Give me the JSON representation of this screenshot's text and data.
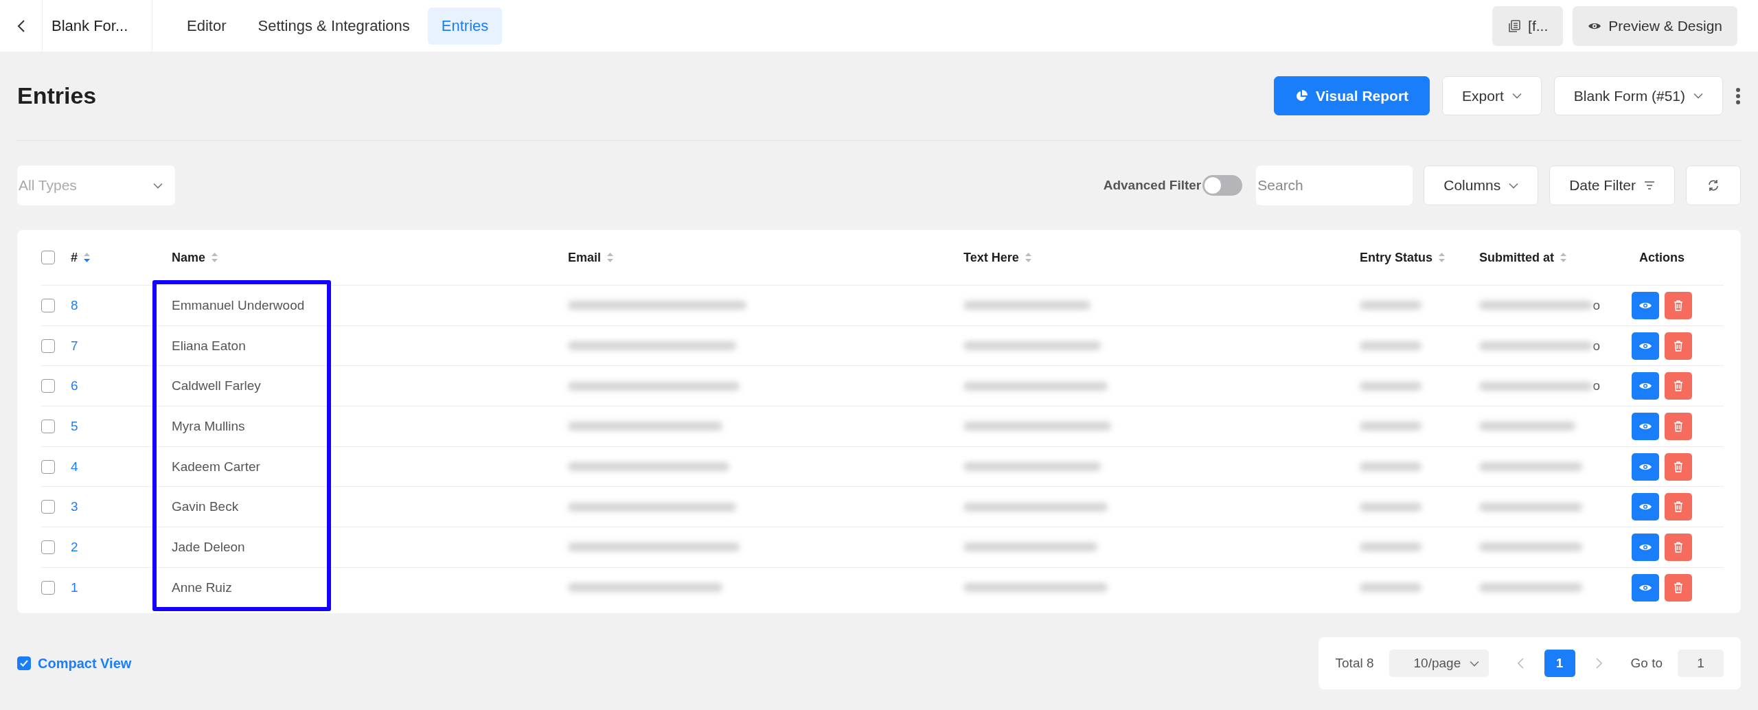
{
  "topbar": {
    "form_title": "Blank For...",
    "tabs": [
      {
        "label": "Editor",
        "selected": false
      },
      {
        "label": "Settings & Integrations",
        "selected": false
      },
      {
        "label": "Entries",
        "selected": true
      }
    ],
    "shortcode_button": "[f...",
    "preview_button": "Preview & Design"
  },
  "header": {
    "title": "Entries",
    "visual_report": "Visual Report",
    "export": "Export",
    "form_select": "Blank Form (#51)"
  },
  "filters": {
    "type_select": {
      "placeholder": "All Types"
    },
    "advanced_filter": {
      "label": "Advanced Filter",
      "on": false
    },
    "search": {
      "placeholder": "Search"
    },
    "columns_button": "Columns",
    "date_filter_button": "Date Filter"
  },
  "table": {
    "select_all": {
      "checked": false
    },
    "name_column_highlighted": true,
    "columns": [
      {
        "label": "#",
        "sortable": true,
        "sorted_desc": true
      },
      {
        "label": "Name",
        "sortable": true,
        "sorted_desc": false
      },
      {
        "label": "Email",
        "sortable": true,
        "sorted_desc": false
      },
      {
        "label": "Text Here",
        "sortable": true,
        "sorted_desc": false
      },
      {
        "label": "Entry Status",
        "sortable": true,
        "sorted_desc": false
      },
      {
        "label": "Submitted at",
        "sortable": true,
        "sorted_desc": false
      },
      {
        "label": "Actions",
        "sortable": false
      }
    ],
    "rows": [
      {
        "id": "8",
        "name": "Emmanuel Underwood",
        "checked": false,
        "submitted_tail": "o"
      },
      {
        "id": "7",
        "name": "Eliana Eaton",
        "checked": false,
        "submitted_tail": "o"
      },
      {
        "id": "6",
        "name": "Caldwell Farley",
        "checked": false,
        "submitted_tail": "o"
      },
      {
        "id": "5",
        "name": "Myra Mullins",
        "checked": false
      },
      {
        "id": "4",
        "name": "Kadeem Carter",
        "checked": false
      },
      {
        "id": "3",
        "name": "Gavin Beck",
        "checked": false
      },
      {
        "id": "2",
        "name": "Jade Deleon",
        "checked": false
      },
      {
        "id": "1",
        "name": "Anne Ruiz",
        "checked": false
      }
    ]
  },
  "compact_view": {
    "label": "Compact View",
    "checked": true
  },
  "pagination": {
    "total": "Total 8",
    "page_size": "10/page",
    "pages": [
      {
        "label": "1",
        "selected": true
      }
    ],
    "goto_label": "Go to",
    "goto_value": "1"
  }
}
